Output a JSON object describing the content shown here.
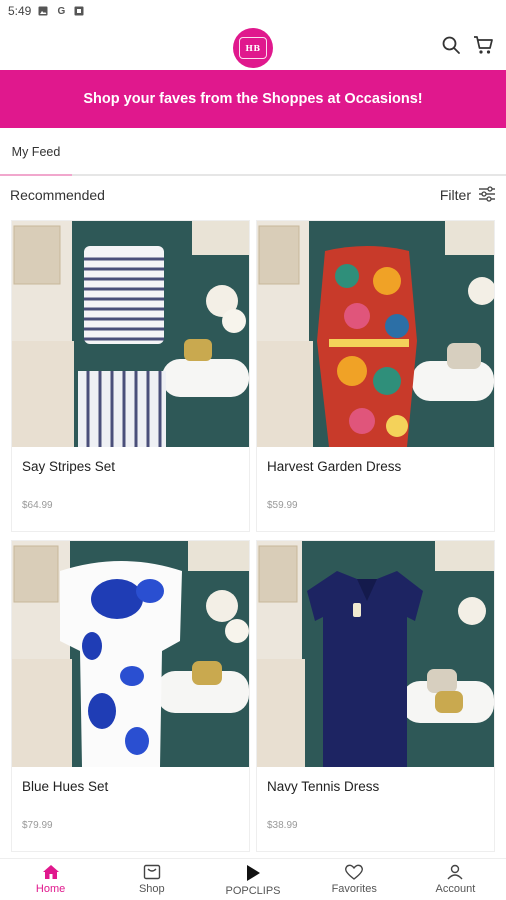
{
  "status_bar": {
    "time": "5:49",
    "icons": [
      "photo-icon",
      "google-g-icon",
      "app-square-icon"
    ]
  },
  "header": {
    "logo_text": "HB",
    "icons": [
      "search-icon",
      "cart-icon"
    ]
  },
  "promo_banner": {
    "text": "Shop your faves from the Shoppes at Occasions!",
    "color": "#e0188d"
  },
  "tabs": [
    {
      "label": "My Feed",
      "active": true
    }
  ],
  "feed": {
    "section_title": "Recommended",
    "filter_label": "Filter"
  },
  "products": [
    {
      "name": "Say Stripes Set",
      "price": "$64.99"
    },
    {
      "name": "Harvest Garden Dress",
      "price": "$59.99"
    },
    {
      "name": "Blue Hues Set",
      "price": "$79.99"
    },
    {
      "name": "Navy Tennis Dress",
      "price": "$38.99"
    }
  ],
  "bottom_nav": [
    {
      "label": "Home",
      "icon": "home-icon",
      "active": true
    },
    {
      "label": "Shop",
      "icon": "shop-icon",
      "active": false
    },
    {
      "label": "POPCLIPS",
      "icon": "play-icon",
      "active": false
    },
    {
      "label": "Favorites",
      "icon": "heart-icon",
      "active": false
    },
    {
      "label": "Account",
      "icon": "person-icon",
      "active": false
    }
  ],
  "colors": {
    "accent": "#e0188d",
    "wall": "#2f5a5a",
    "background": "#ffffff"
  }
}
